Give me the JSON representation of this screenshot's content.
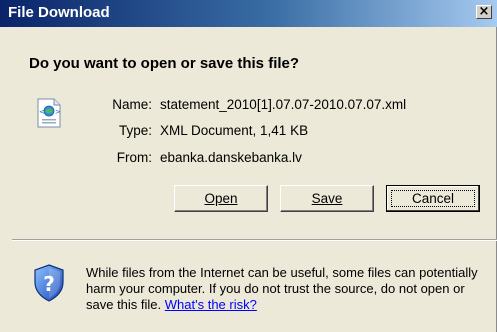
{
  "window": {
    "title": "File Download"
  },
  "prompt": {
    "heading": "Do you want to open or save this file?"
  },
  "file": {
    "icon": "xml-document-icon",
    "name_label": "Name:",
    "name_value": "statement_2010[1].07.07-2010.07.07.xml",
    "type_label": "Type:",
    "type_value": "XML Document, 1,41 KB",
    "from_label": "From:",
    "from_value": "ebanka.danskebanka.lv"
  },
  "buttons": {
    "open_label": "Open",
    "save_label": "Save",
    "cancel_label": "Cancel",
    "close_glyph": "×"
  },
  "warning": {
    "icon": "shield-question-icon",
    "text": "While files from the Internet can be useful, some files can potentially harm your computer. If you do not trust the source, do not open or save this file.",
    "link": "What's the risk?"
  },
  "colors": {
    "titlebar": "#0a246a",
    "dialog_bg": "#ece9d8",
    "link": "#0000ff"
  }
}
